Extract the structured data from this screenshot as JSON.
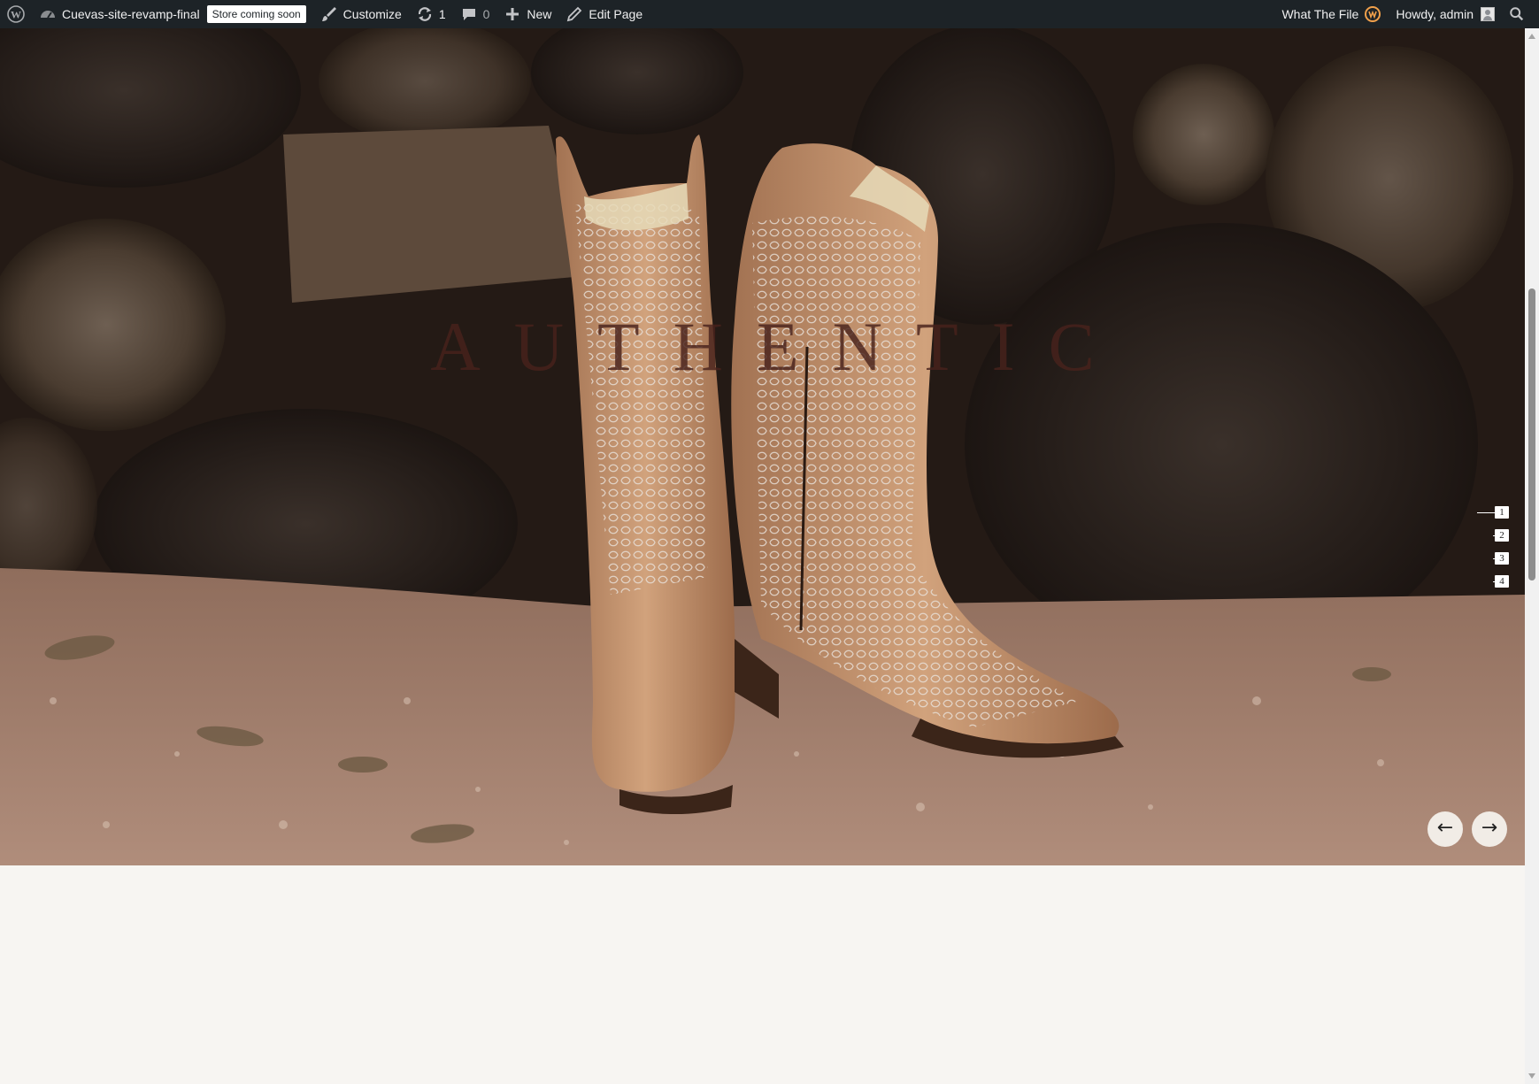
{
  "adminbar": {
    "site_name": "Cuevas-site-revamp-final",
    "store_badge": "Store coming soon",
    "customize": "Customize",
    "updates_count": "1",
    "comments_count": "0",
    "new": "New",
    "edit_page": "Edit Page",
    "plugin": "What The File",
    "greeting": "Howdy, admin"
  },
  "hero": {
    "title": "AUTHENTIC",
    "slides": [
      "1",
      "2",
      "3",
      "4"
    ],
    "active_slide": 1,
    "prev_arrow": "←",
    "next_arrow": "→"
  },
  "colors": {
    "adminbar_bg": "#1d2327",
    "page_bg": "#f7f5f2",
    "title_color": "#48221c"
  }
}
